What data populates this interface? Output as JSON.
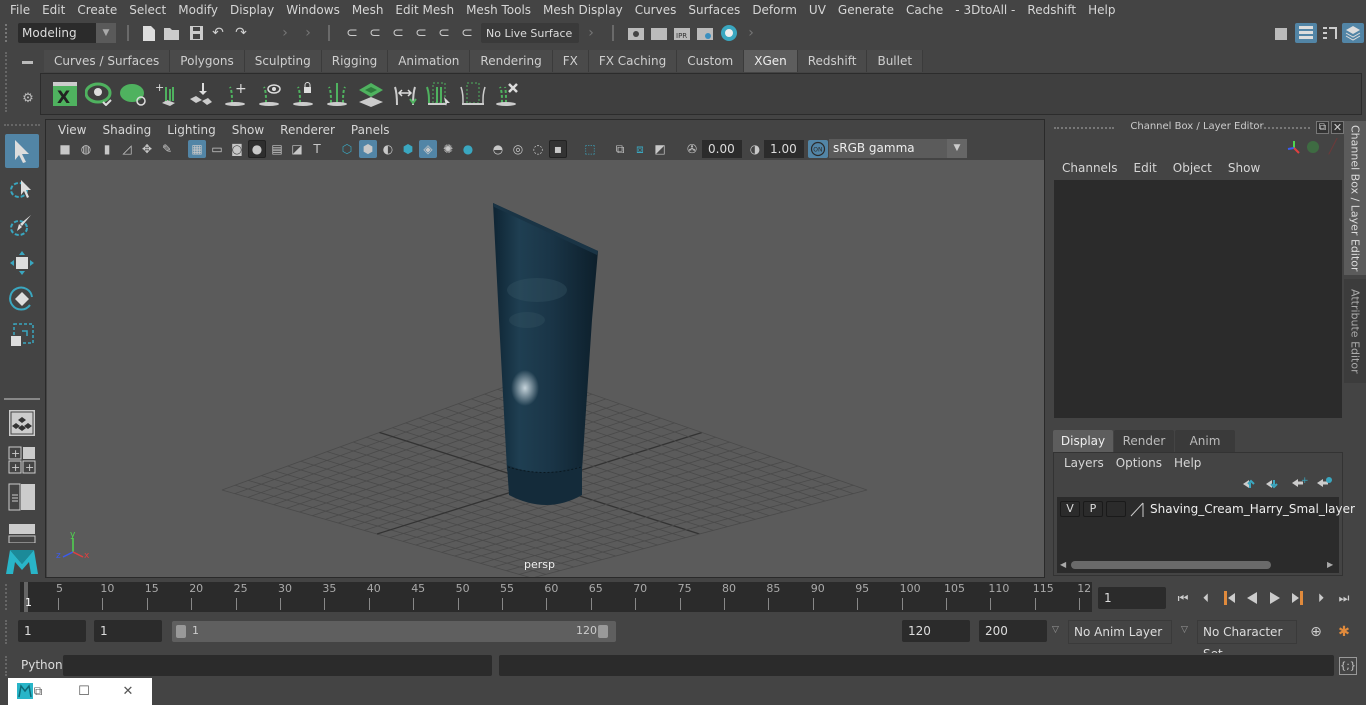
{
  "menubar": {
    "items": [
      "File",
      "Edit",
      "Create",
      "Select",
      "Modify",
      "Display",
      "Windows",
      "Mesh",
      "Edit Mesh",
      "Mesh Tools",
      "Mesh Display",
      "Curves",
      "Surfaces",
      "Deform",
      "UV",
      "Generate",
      "Cache",
      "- 3DtoAll -",
      "Redshift",
      "Help"
    ]
  },
  "statusline": {
    "mode": "Modeling",
    "live_surface": "No Live Surface"
  },
  "shelf": {
    "tabs": [
      "Curves / Surfaces",
      "Polygons",
      "Sculpting",
      "Rigging",
      "Animation",
      "Rendering",
      "FX",
      "FX Caching",
      "Custom",
      "XGen",
      "Redshift",
      "Bullet"
    ],
    "active_tab": "XGen",
    "icons": [
      "xgen-editor-icon",
      "preview-icon",
      "clear-preview-icon",
      "add-guides-icon",
      "place-guides-icon",
      "add-guide-icon",
      "show-guides-icon",
      "lock-guides-icon",
      "split-guides-icon",
      "create-description-icon",
      "transfer-guides-icon",
      "select-guides-icon",
      "select-region-icon",
      "delete-guides-icon"
    ]
  },
  "viewport": {
    "menu": [
      "View",
      "Shading",
      "Lighting",
      "Show",
      "Renderer",
      "Panels"
    ],
    "exposure": "0.00",
    "gamma": "1.00",
    "color_toggle": "ON",
    "color_space": "sRGB gamma",
    "camera": "persp",
    "axis": {
      "x": "x",
      "y": "y",
      "z": "z"
    }
  },
  "channel_box": {
    "title": "Channel Box / Layer Editor",
    "menu": [
      "Channels",
      "Edit",
      "Object",
      "Show"
    ]
  },
  "layer_editor": {
    "tabs": [
      "Display",
      "Render",
      "Anim"
    ],
    "active_tab": "Display",
    "menu": [
      "Layers",
      "Options",
      "Help"
    ],
    "layers": [
      {
        "v": "V",
        "p": "P",
        "name": "Shaving_Cream_Harry_Smal_layer"
      }
    ]
  },
  "side_tabs": [
    "Channel Box / Layer Editor",
    "Attribute Editor"
  ],
  "timeline": {
    "ticks": [
      5,
      10,
      15,
      20,
      25,
      30,
      35,
      40,
      45,
      50,
      55,
      60,
      65,
      70,
      75,
      80,
      85,
      90,
      95,
      100,
      105,
      110,
      115,
      "12"
    ],
    "current_frame_marker": "1",
    "current_frame": "1"
  },
  "range": {
    "start_frame": "1",
    "playback_start": "1",
    "slider_start": "1",
    "slider_end": "120",
    "playback_end": "120",
    "end_frame": "200",
    "anim_layer": "No Anim Layer",
    "character_set": "No Character Set"
  },
  "cmdline": {
    "language": "Python"
  }
}
